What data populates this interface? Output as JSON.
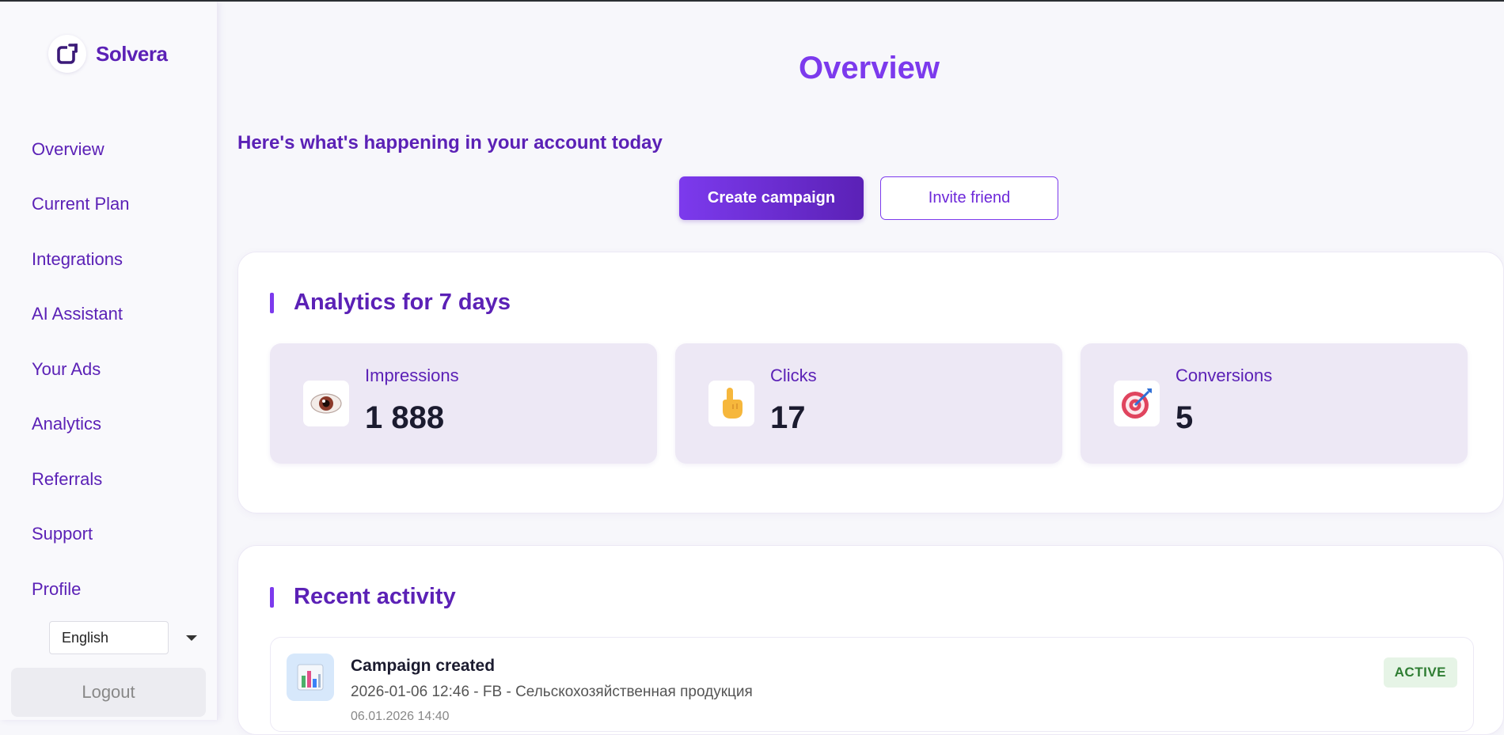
{
  "app": {
    "name": "Solvera",
    "accent": "#7c3aed",
    "accent_dark": "#5b21b6"
  },
  "sidebar": {
    "items": [
      {
        "label": "Overview"
      },
      {
        "label": "Current Plan"
      },
      {
        "label": "Integrations"
      },
      {
        "label": "AI Assistant"
      },
      {
        "label": "Your Ads"
      },
      {
        "label": "Analytics"
      },
      {
        "label": "Referrals"
      },
      {
        "label": "Support"
      },
      {
        "label": "Profile"
      }
    ],
    "language": {
      "selected": "English"
    },
    "logout_label": "Logout"
  },
  "main": {
    "title": "Overview",
    "subtitle": "Here's what's happening in your account today",
    "create_campaign_label": "Create campaign",
    "invite_friend_label": "Invite friend"
  },
  "analytics": {
    "title": "Analytics for 7 days",
    "stats": [
      {
        "label": "Impressions",
        "value": "1 888",
        "icon": "eye-icon"
      },
      {
        "label": "Clicks",
        "value": "17",
        "icon": "pointing-hand-icon"
      },
      {
        "label": "Conversions",
        "value": "5",
        "icon": "target-icon"
      }
    ]
  },
  "activity": {
    "title": "Recent activity",
    "items": [
      {
        "title": "Campaign created",
        "meta": "2026-01-06 12:46 - FB - Сельскохозяйственная продукция",
        "date": "06.01.2026 14:40",
        "status": "ACTIVE",
        "icon": "bar-chart-icon",
        "status_color": "#2e7d32"
      }
    ]
  }
}
